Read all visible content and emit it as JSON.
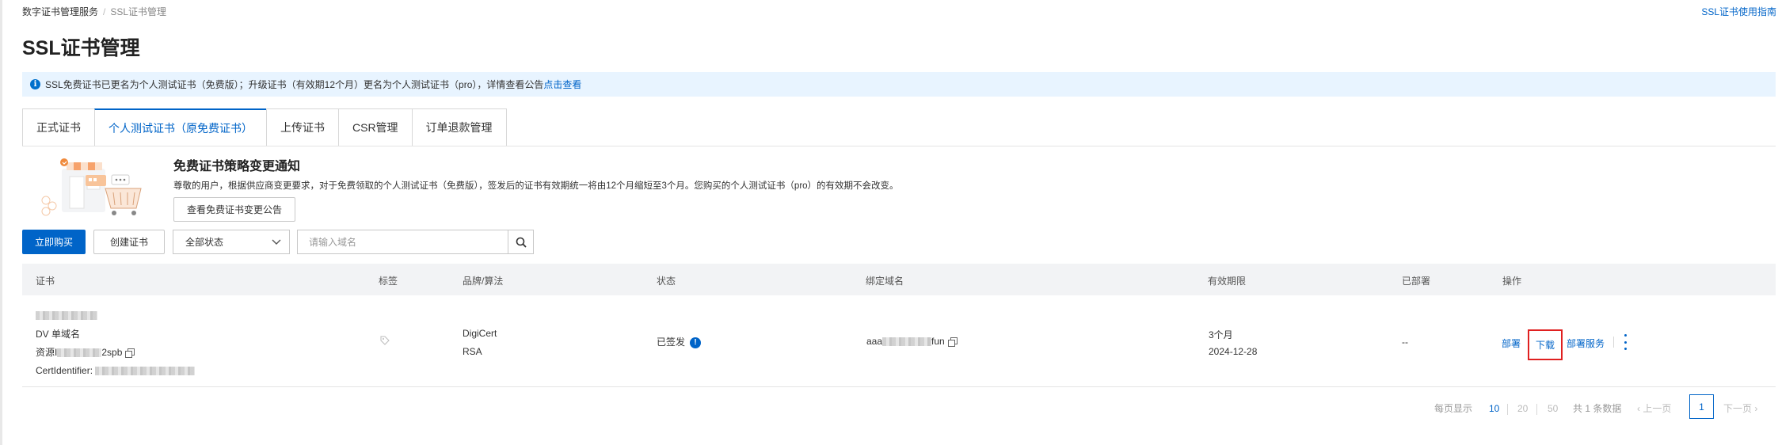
{
  "breadcrumb": {
    "parent": "数字证书管理服务",
    "separator": "/",
    "current": "SSL证书管理"
  },
  "header": {
    "help_link": "SSL证书使用指南",
    "title": "SSL证书管理"
  },
  "notice": {
    "text": "SSL免费证书已更名为个人测试证书（免费版）；升级证书（有效期12个月）更名为个人测试证书（pro），详情查看公告",
    "link": "点击查看"
  },
  "tabs": [
    {
      "label": "正式证书",
      "active": false
    },
    {
      "label": "个人测试证书（原免费证书）",
      "active": true
    },
    {
      "label": "上传证书",
      "active": false
    },
    {
      "label": "CSR管理",
      "active": false
    },
    {
      "label": "订单退款管理",
      "active": false
    }
  ],
  "promo": {
    "title": "免费证书策略变更通知",
    "description": "尊敬的用户，根据供应商变更要求，对于免费领取的个人测试证书（免费版），签发后的证书有效期统一将由12个月缩短至3个月。您购买的个人测试证书（pro）的有效期不会改变。",
    "button": "查看免费证书变更公告"
  },
  "toolbar": {
    "buy": "立即购买",
    "create": "创建证书",
    "status_filter": "全部状态",
    "search_placeholder": "请输入域名"
  },
  "table": {
    "columns": [
      "证书",
      "标签",
      "品牌/算法",
      "状态",
      "绑定域名",
      "有效期限",
      "已部署",
      "操作"
    ],
    "rows": [
      {
        "cert_type": "DV 单域名",
        "resource_prefix": "资源I",
        "resource_suffix": "2spb",
        "cert_identifier_label": "CertIdentifier:",
        "brand": "DigiCert",
        "algorithm": "RSA",
        "status": "已签发",
        "domain_prefix": "aaa",
        "domain_suffix": "fun",
        "validity": "3个月",
        "expiry": "2024-12-28",
        "deployed": "--",
        "actions": {
          "deploy": "部署",
          "download": "下载",
          "deploy_service": "部署服务"
        }
      }
    ]
  },
  "pagination": {
    "per_page_label": "每页显示",
    "sizes": [
      "10",
      "20",
      "50"
    ],
    "selected_size": "10",
    "total": "共 1 条数据",
    "prev": "上一页",
    "current_page": "1",
    "next": "下一页"
  },
  "colors": {
    "primary": "#0064c8",
    "notice_bg": "#e8f4ff",
    "highlight": "#e02020"
  }
}
